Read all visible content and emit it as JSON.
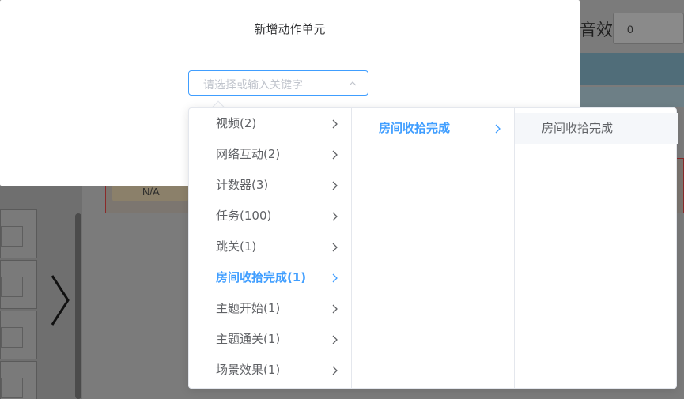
{
  "dialog": {
    "title": "新增动作单元"
  },
  "cascader": {
    "placeholder": "请选择或输入关键字"
  },
  "menu_level1": [
    {
      "label": "视频(2)"
    },
    {
      "label": "网络互动(2)"
    },
    {
      "label": "计数器(3)"
    },
    {
      "label": "任务(100)"
    },
    {
      "label": "跳关(1)"
    },
    {
      "label": "房间收拾完成(1)",
      "active": true
    },
    {
      "label": "主题开始(1)"
    },
    {
      "label": "主题通关(1)"
    },
    {
      "label": "场景效果(1)"
    }
  ],
  "menu_level2": [
    {
      "label": "房间收拾完成",
      "active": true
    }
  ],
  "menu_level3": [
    {
      "label": "房间收拾完成"
    }
  ],
  "background": {
    "sound_label": "音效",
    "sound_value": "0",
    "card_text": "N/A"
  },
  "colors": {
    "accent": "#409eff",
    "text": "#606266",
    "overlay": "#737373"
  }
}
